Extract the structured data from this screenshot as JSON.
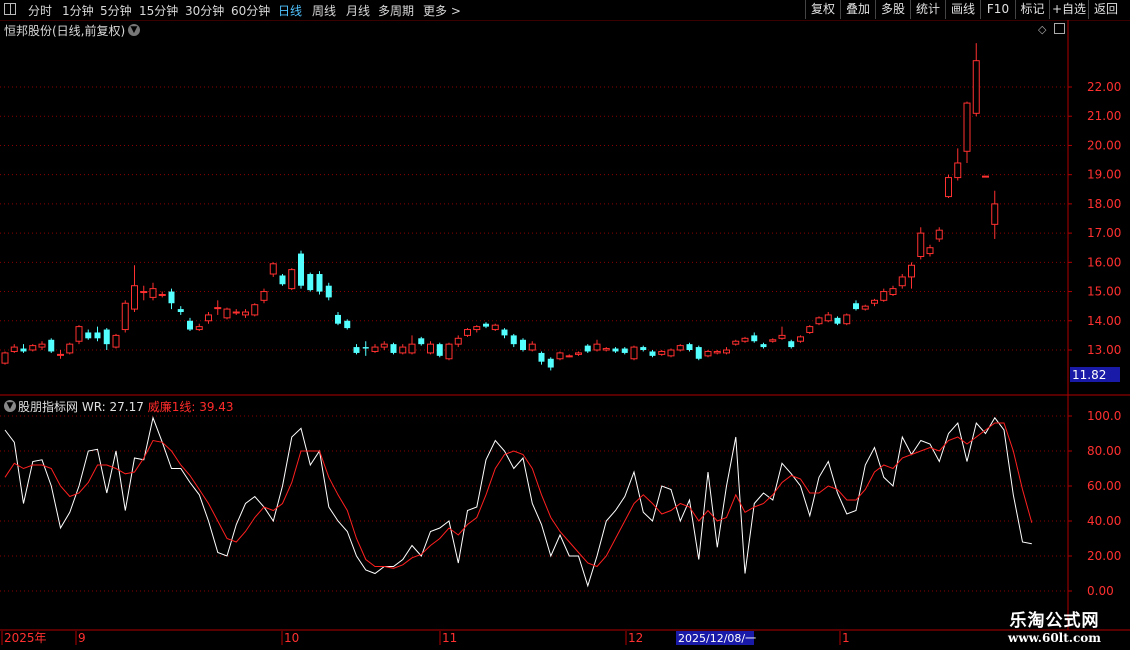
{
  "toolbar": {
    "periods": [
      "分时",
      "1分钟",
      "5分钟",
      "15分钟",
      "30分钟",
      "60分钟",
      "日线",
      "周线",
      "月线",
      "多周期",
      "更多 >"
    ],
    "active_period": "日线",
    "right_buttons": [
      "复权",
      "叠加",
      "多股",
      "统计",
      "画线",
      "F10",
      "标记",
      "+自选",
      "返回"
    ]
  },
  "main_chart": {
    "title": "恒邦股份(日线,前复权)",
    "last_price_tag": "11.82",
    "y_ticks": [
      "22.00",
      "21.00",
      "20.00",
      "19.00",
      "18.00",
      "17.00",
      "16.00",
      "15.00",
      "14.00",
      "13.00"
    ]
  },
  "indicator": {
    "name": "股朋指标网",
    "wr_label": "WR: 27.17",
    "line_label": "威廉1线: 39.43",
    "y_ticks": [
      "100.0",
      "80.00",
      "60.00",
      "40.00",
      "20.00",
      "0.00"
    ]
  },
  "x_axis": {
    "labels": [
      "2025年",
      "9",
      "10",
      "11",
      "12",
      "1"
    ],
    "cursor_date": "2025/12/08/一"
  },
  "watermark": {
    "line1": "乐淘公式网",
    "line2": "www.60lt.com"
  },
  "colors": {
    "up": "#ff3030",
    "down": "#54ffff",
    "wr": "#ffffff",
    "wr_avg": "#ff2020",
    "grid": "#8a0000"
  },
  "chart_data": {
    "type": "candlestick",
    "title": "恒邦股份(日线,前复权)",
    "x_labels": [
      "2025年",
      "9",
      "10",
      "11",
      "12",
      "1"
    ],
    "candles": [
      {
        "o": 12.55,
        "c": 12.9,
        "h": 12.95,
        "l": 12.5
      },
      {
        "o": 12.95,
        "c": 13.1,
        "h": 13.2,
        "l": 12.9
      },
      {
        "o": 13.05,
        "c": 12.95,
        "h": 13.2,
        "l": 12.9
      },
      {
        "o": 13.0,
        "c": 13.15,
        "h": 13.2,
        "l": 12.95
      },
      {
        "o": 13.1,
        "c": 13.2,
        "h": 13.3,
        "l": 13.0
      },
      {
        "o": 13.35,
        "c": 12.95,
        "h": 13.4,
        "l": 12.9
      },
      {
        "o": 12.85,
        "c": 12.85,
        "h": 13.0,
        "l": 12.7
      },
      {
        "o": 12.9,
        "c": 13.2,
        "h": 13.25,
        "l": 12.85
      },
      {
        "o": 13.3,
        "c": 13.8,
        "h": 13.85,
        "l": 13.2
      },
      {
        "o": 13.6,
        "c": 13.4,
        "h": 13.7,
        "l": 13.35
      },
      {
        "o": 13.6,
        "c": 13.4,
        "h": 13.8,
        "l": 13.3
      },
      {
        "o": 13.7,
        "c": 13.2,
        "h": 13.75,
        "l": 13.0
      },
      {
        "o": 13.1,
        "c": 13.5,
        "h": 13.55,
        "l": 13.05
      },
      {
        "o": 13.7,
        "c": 14.6,
        "h": 14.7,
        "l": 13.6
      },
      {
        "o": 14.4,
        "c": 15.2,
        "h": 15.9,
        "l": 14.3
      },
      {
        "o": 15.0,
        "c": 15.0,
        "h": 15.2,
        "l": 14.7
      },
      {
        "o": 14.8,
        "c": 15.1,
        "h": 15.3,
        "l": 14.7
      },
      {
        "o": 14.9,
        "c": 14.9,
        "h": 15.0,
        "l": 14.8
      },
      {
        "o": 15.0,
        "c": 14.6,
        "h": 15.1,
        "l": 14.4
      },
      {
        "o": 14.4,
        "c": 14.3,
        "h": 14.5,
        "l": 14.2
      },
      {
        "o": 14.0,
        "c": 13.7,
        "h": 14.1,
        "l": 13.65
      },
      {
        "o": 13.7,
        "c": 13.8,
        "h": 13.9,
        "l": 13.65
      },
      {
        "o": 14.0,
        "c": 14.2,
        "h": 14.3,
        "l": 13.9
      },
      {
        "o": 14.45,
        "c": 14.45,
        "h": 14.7,
        "l": 14.2
      },
      {
        "o": 14.1,
        "c": 14.4,
        "h": 14.45,
        "l": 14.05
      },
      {
        "o": 14.3,
        "c": 14.3,
        "h": 14.4,
        "l": 14.2
      },
      {
        "o": 14.2,
        "c": 14.3,
        "h": 14.4,
        "l": 14.1
      },
      {
        "o": 14.2,
        "c": 14.55,
        "h": 14.6,
        "l": 14.15
      },
      {
        "o": 14.7,
        "c": 15.0,
        "h": 15.1,
        "l": 14.6
      },
      {
        "o": 15.6,
        "c": 15.95,
        "h": 16.0,
        "l": 15.5
      },
      {
        "o": 15.55,
        "c": 15.25,
        "h": 15.6,
        "l": 15.2
      },
      {
        "o": 15.1,
        "c": 15.75,
        "h": 15.8,
        "l": 15.05
      },
      {
        "o": 16.3,
        "c": 15.2,
        "h": 16.4,
        "l": 15.1
      },
      {
        "o": 15.6,
        "c": 15.05,
        "h": 15.65,
        "l": 15.0
      },
      {
        "o": 15.6,
        "c": 15.0,
        "h": 15.7,
        "l": 14.9
      },
      {
        "o": 15.2,
        "c": 14.8,
        "h": 15.3,
        "l": 14.7
      },
      {
        "o": 14.2,
        "c": 13.9,
        "h": 14.3,
        "l": 13.85
      },
      {
        "o": 14.0,
        "c": 13.75,
        "h": 14.05,
        "l": 13.7
      },
      {
        "o": 13.1,
        "c": 12.9,
        "h": 13.2,
        "l": 12.85
      },
      {
        "o": 13.1,
        "c": 13.05,
        "h": 13.3,
        "l": 12.8
      },
      {
        "o": 12.95,
        "c": 13.1,
        "h": 13.2,
        "l": 12.9
      },
      {
        "o": 13.1,
        "c": 13.2,
        "h": 13.3,
        "l": 13.0
      },
      {
        "o": 13.2,
        "c": 12.9,
        "h": 13.25,
        "l": 12.85
      },
      {
        "o": 12.9,
        "c": 13.1,
        "h": 13.2,
        "l": 12.85
      },
      {
        "o": 12.9,
        "c": 13.2,
        "h": 13.5,
        "l": 12.85
      },
      {
        "o": 13.4,
        "c": 13.2,
        "h": 13.45,
        "l": 13.15
      },
      {
        "o": 12.9,
        "c": 13.2,
        "h": 13.3,
        "l": 12.85
      },
      {
        "o": 13.2,
        "c": 12.8,
        "h": 13.25,
        "l": 12.75
      },
      {
        "o": 12.7,
        "c": 13.2,
        "h": 13.25,
        "l": 12.65
      },
      {
        "o": 13.2,
        "c": 13.4,
        "h": 13.5,
        "l": 13.1
      },
      {
        "o": 13.5,
        "c": 13.7,
        "h": 13.75,
        "l": 13.45
      },
      {
        "o": 13.7,
        "c": 13.8,
        "h": 13.85,
        "l": 13.6
      },
      {
        "o": 13.9,
        "c": 13.8,
        "h": 13.95,
        "l": 13.75
      },
      {
        "o": 13.7,
        "c": 13.85,
        "h": 13.9,
        "l": 13.65
      },
      {
        "o": 13.7,
        "c": 13.5,
        "h": 13.75,
        "l": 13.4
      },
      {
        "o": 13.5,
        "c": 13.2,
        "h": 13.55,
        "l": 13.1
      },
      {
        "o": 13.35,
        "c": 13.0,
        "h": 13.4,
        "l": 12.95
      },
      {
        "o": 13.0,
        "c": 13.2,
        "h": 13.3,
        "l": 12.95
      },
      {
        "o": 12.9,
        "c": 12.6,
        "h": 12.95,
        "l": 12.5
      },
      {
        "o": 12.7,
        "c": 12.4,
        "h": 12.75,
        "l": 12.3
      },
      {
        "o": 12.7,
        "c": 12.9,
        "h": 12.95,
        "l": 12.65
      },
      {
        "o": 12.8,
        "c": 12.8,
        "h": 12.85,
        "l": 12.75
      },
      {
        "o": 12.85,
        "c": 12.9,
        "h": 12.95,
        "l": 12.8
      },
      {
        "o": 13.15,
        "c": 12.95,
        "h": 13.2,
        "l": 12.9
      },
      {
        "o": 13.0,
        "c": 13.2,
        "h": 13.35,
        "l": 12.95
      },
      {
        "o": 13.0,
        "c": 13.05,
        "h": 13.1,
        "l": 12.95
      },
      {
        "o": 13.05,
        "c": 12.95,
        "h": 13.1,
        "l": 12.9
      },
      {
        "o": 13.05,
        "c": 12.9,
        "h": 13.1,
        "l": 12.85
      },
      {
        "o": 12.7,
        "c": 13.1,
        "h": 13.15,
        "l": 12.65
      },
      {
        "o": 13.1,
        "c": 13.0,
        "h": 13.15,
        "l": 12.95
      },
      {
        "o": 12.95,
        "c": 12.8,
        "h": 13.0,
        "l": 12.75
      },
      {
        "o": 12.85,
        "c": 12.95,
        "h": 13.0,
        "l": 12.8
      },
      {
        "o": 12.8,
        "c": 13.0,
        "h": 13.05,
        "l": 12.75
      },
      {
        "o": 13.0,
        "c": 13.15,
        "h": 13.2,
        "l": 12.95
      },
      {
        "o": 13.2,
        "c": 13.0,
        "h": 13.25,
        "l": 12.95
      },
      {
        "o": 13.1,
        "c": 12.7,
        "h": 13.15,
        "l": 12.65
      },
      {
        "o": 12.8,
        "c": 12.95,
        "h": 13.0,
        "l": 12.75
      },
      {
        "o": 12.9,
        "c": 12.95,
        "h": 13.0,
        "l": 12.85
      },
      {
        "o": 12.9,
        "c": 13.0,
        "h": 13.1,
        "l": 12.85
      },
      {
        "o": 13.2,
        "c": 13.3,
        "h": 13.35,
        "l": 13.15
      },
      {
        "o": 13.3,
        "c": 13.4,
        "h": 13.45,
        "l": 13.25
      },
      {
        "o": 13.5,
        "c": 13.3,
        "h": 13.6,
        "l": 13.25
      },
      {
        "o": 13.2,
        "c": 13.1,
        "h": 13.25,
        "l": 13.05
      },
      {
        "o": 13.3,
        "c": 13.35,
        "h": 13.4,
        "l": 13.25
      },
      {
        "o": 13.4,
        "c": 13.5,
        "h": 13.8,
        "l": 13.35
      },
      {
        "o": 13.3,
        "c": 13.1,
        "h": 13.35,
        "l": 13.05
      },
      {
        "o": 13.3,
        "c": 13.45,
        "h": 13.5,
        "l": 13.25
      },
      {
        "o": 13.6,
        "c": 13.8,
        "h": 13.85,
        "l": 13.55
      },
      {
        "o": 13.9,
        "c": 14.1,
        "h": 14.15,
        "l": 13.85
      },
      {
        "o": 14.0,
        "c": 14.2,
        "h": 14.3,
        "l": 13.95
      },
      {
        "o": 14.1,
        "c": 13.9,
        "h": 14.15,
        "l": 13.85
      },
      {
        "o": 13.9,
        "c": 14.2,
        "h": 14.25,
        "l": 13.85
      },
      {
        "o": 14.6,
        "c": 14.4,
        "h": 14.7,
        "l": 14.35
      },
      {
        "o": 14.4,
        "c": 14.5,
        "h": 14.55,
        "l": 14.35
      },
      {
        "o": 14.6,
        "c": 14.7,
        "h": 14.75,
        "l": 14.5
      },
      {
        "o": 14.7,
        "c": 15.0,
        "h": 15.1,
        "l": 14.65
      },
      {
        "o": 14.9,
        "c": 15.1,
        "h": 15.2,
        "l": 14.85
      },
      {
        "o": 15.2,
        "c": 15.5,
        "h": 15.6,
        "l": 15.1
      },
      {
        "o": 15.5,
        "c": 15.9,
        "h": 16.0,
        "l": 15.1
      },
      {
        "o": 16.2,
        "c": 17.0,
        "h": 17.2,
        "l": 16.1
      },
      {
        "o": 16.3,
        "c": 16.5,
        "h": 16.6,
        "l": 16.2
      },
      {
        "o": 16.8,
        "c": 17.1,
        "h": 17.2,
        "l": 16.7
      },
      {
        "o": 18.25,
        "c": 18.9,
        "h": 19.0,
        "l": 18.2
      },
      {
        "o": 18.9,
        "c": 19.4,
        "h": 19.9,
        "l": 18.8
      },
      {
        "o": 19.8,
        "c": 21.45,
        "h": 21.5,
        "l": 19.4
      },
      {
        "o": 21.1,
        "c": 22.9,
        "h": 23.5,
        "l": 21.0
      },
      {
        "o": 18.95,
        "c": 18.95,
        "h": 18.95,
        "l": 18.95
      },
      {
        "o": 17.3,
        "c": 18.0,
        "h": 18.45,
        "l": 16.8
      }
    ],
    "price_ylim": [
      12.2,
      23.5
    ],
    "series": [
      {
        "name": "WR",
        "values": [
          92,
          85,
          50,
          74,
          75,
          60,
          36,
          45,
          60,
          80,
          81,
          56,
          80,
          46,
          76,
          75,
          99,
          85,
          70,
          70,
          62,
          55,
          40,
          22,
          20,
          38,
          50,
          54,
          48,
          40,
          60,
          88,
          93,
          72,
          80,
          48,
          40,
          34,
          20,
          12,
          10,
          14,
          14,
          18,
          26,
          20,
          34,
          36,
          40,
          16,
          46,
          48,
          75,
          86,
          80,
          70,
          76,
          50,
          38,
          20,
          32,
          20,
          20,
          3,
          20,
          40,
          46,
          54,
          68,
          45,
          40,
          60,
          58,
          40,
          52,
          18,
          68,
          25,
          60,
          88,
          10,
          50,
          56,
          52,
          73,
          67,
          60,
          43,
          65,
          74,
          56,
          44,
          46,
          72,
          82,
          65,
          60,
          88,
          78,
          86,
          84,
          74,
          90,
          96,
          74,
          96,
          90,
          99,
          92,
          55,
          28,
          27
        ]
      },
      {
        "name": "威廉1线",
        "values": [
          65,
          73,
          70,
          72,
          72,
          70,
          60,
          54,
          56,
          62,
          72,
          72,
          70,
          67,
          68,
          76,
          86,
          85,
          80,
          72,
          66,
          58,
          50,
          40,
          30,
          28,
          34,
          42,
          48,
          46,
          50,
          62,
          80,
          80,
          80,
          65,
          55,
          46,
          30,
          18,
          14,
          14,
          13,
          15,
          19,
          21,
          26,
          30,
          36,
          32,
          38,
          42,
          55,
          70,
          78,
          80,
          78,
          70,
          55,
          42,
          34,
          28,
          22,
          16,
          14,
          20,
          30,
          40,
          50,
          55,
          50,
          44,
          46,
          50,
          48,
          40,
          46,
          40,
          42,
          55,
          45,
          48,
          50,
          55,
          62,
          66,
          64,
          56,
          56,
          60,
          58,
          52,
          52,
          58,
          68,
          72,
          70,
          76,
          78,
          80,
          82,
          80,
          86,
          88,
          84,
          88,
          92,
          96,
          96,
          80,
          58,
          39
        ]
      }
    ],
    "wr_ylim": [
      0,
      100
    ]
  }
}
